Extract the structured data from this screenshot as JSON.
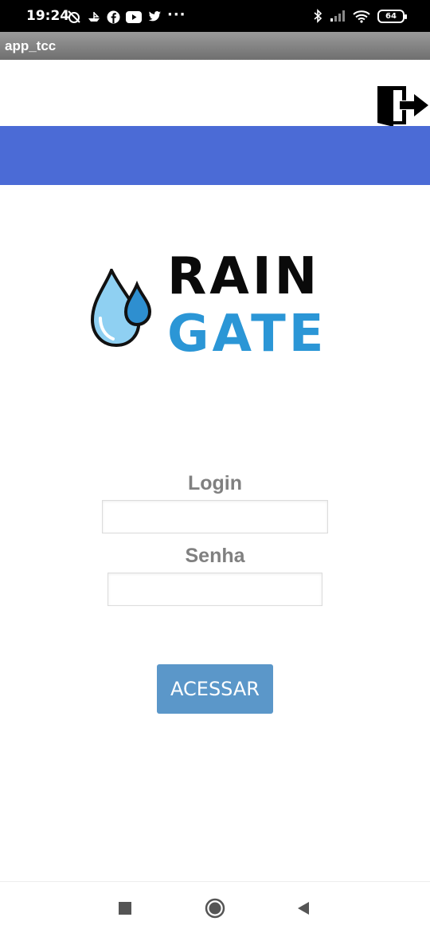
{
  "status_bar": {
    "time": "19:24",
    "dots": "···",
    "battery": "64"
  },
  "app": {
    "title": "app_tcc",
    "header_band_color": "#4b6bd6"
  },
  "logo": {
    "word_1": "RAIN",
    "word_2": "GATE"
  },
  "form": {
    "login_label": "Login",
    "login_value": "",
    "password_label": "Senha",
    "password_value": "",
    "submit_label": "ACESSAR",
    "submit_color": "#5b97c9"
  },
  "icons": {
    "logout": "logout-door-icon",
    "nav_recents": "square-icon",
    "nav_home": "circle-icon",
    "nav_back": "triangle-back-icon"
  }
}
